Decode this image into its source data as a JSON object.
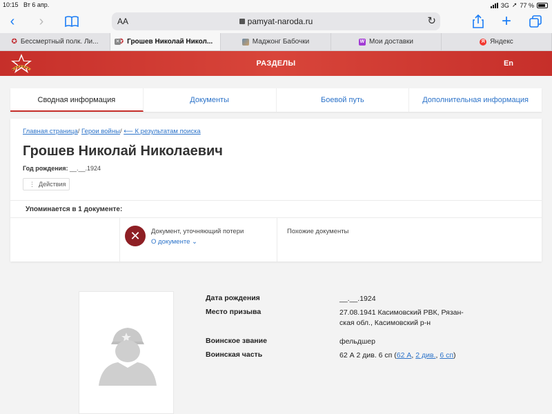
{
  "status": {
    "time": "10:15",
    "date": "Вт 6 апр.",
    "network": "3G",
    "battery": "77 %"
  },
  "browser": {
    "aa_label": "AA",
    "url": "pamyat-naroda.ru",
    "tabs": [
      {
        "label": "Бессмертный полк. Ли...",
        "active": false
      },
      {
        "label": "Грошев Николай Никол...",
        "active": true
      },
      {
        "label": "Маджонг Бабочки",
        "active": false
      },
      {
        "label": "Мои доставки",
        "active": false
      },
      {
        "label": "Яндекс",
        "active": false
      }
    ]
  },
  "header": {
    "sections": "РАЗДЕЛЫ",
    "lang": "En",
    "brand_color": "#c62f2a"
  },
  "page_tabs": [
    "Сводная информация",
    "Документы",
    "Боевой путь",
    "Дополнительная информация"
  ],
  "breadcrumb": {
    "home": "Главная страница",
    "sep1": "/ ",
    "heroes": "Герои войны",
    "sep2": "/ ",
    "back": "⟵ К результатам поиска"
  },
  "person": {
    "name": "Грошев Николай Николаевич",
    "birth_label": "Год рождения:",
    "birth_value": "__.__.1924",
    "actions": "Действия"
  },
  "mentions": "Упоминается в 1 документе:",
  "document": {
    "title": "Документ, уточняющий потери",
    "link": "О документе",
    "similar": "Похожие документы"
  },
  "details": {
    "birth_date_label": "Дата рождения",
    "birth_date_value": "__.__.1924",
    "draft_label": "Место призыва",
    "draft_value_line1": "27.08.1941 Касимовский РВК, Рязан-",
    "draft_value_line2": "ская обл., Касимовский р-н",
    "rank_label": "Воинское звание",
    "rank_value": "фельдшер",
    "unit_label": "Воинская часть",
    "unit_prefix": "62 А 2 див. 6 сп (",
    "unit_link1": "62 А",
    "unit_sep1": ", ",
    "unit_link2": "2 див.",
    "unit_sep2": ", ",
    "unit_link3": "6 сп",
    "unit_suffix": ")"
  }
}
